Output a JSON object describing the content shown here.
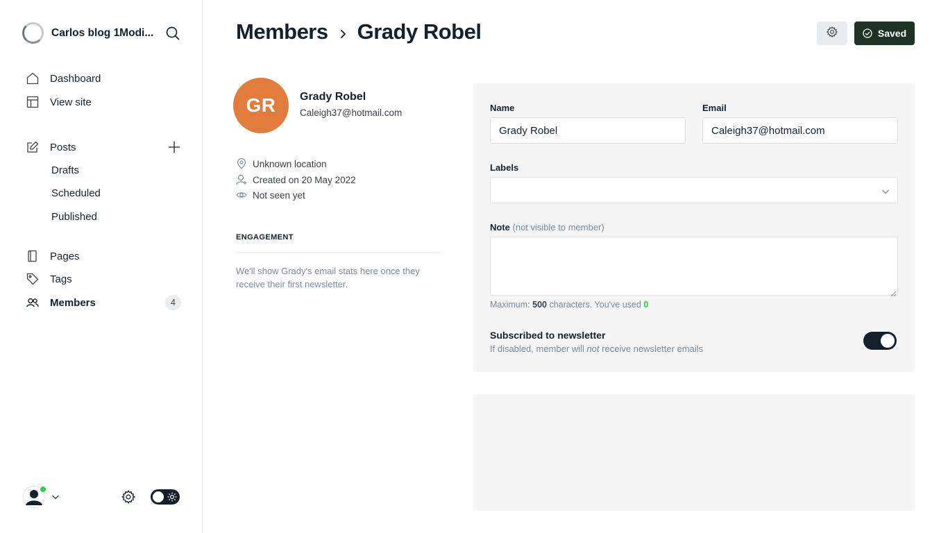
{
  "sidebar": {
    "site_title": "Carlos blog 1Modi...",
    "icons": {
      "brand": "site-logo",
      "search": "search-icon",
      "dashboard": "home-icon",
      "view_site": "layout-icon",
      "posts": "edit-icon",
      "add_post": "plus-icon",
      "pages": "page-icon",
      "tags": "tag-icon",
      "members": "members-icon",
      "settings": "gear-icon",
      "theme": "sun-icon"
    },
    "nav": {
      "dashboard": "Dashboard",
      "view_site": "View site",
      "posts": "Posts",
      "drafts": "Drafts",
      "scheduled": "Scheduled",
      "published": "Published",
      "pages": "Pages",
      "tags": "Tags",
      "members": "Members",
      "members_count": "4"
    },
    "user_status_color": "#30cf43"
  },
  "header": {
    "breadcrumb_parent": "Members",
    "breadcrumb_current": "Grady Robel",
    "saved_label": "Saved",
    "saved_color": "#1c3223"
  },
  "member": {
    "initials": "GR",
    "avatar_color": "#e27c3d",
    "name": "Grady Robel",
    "email": "Caleigh37@hotmail.com",
    "location": "Unknown location",
    "created": "Created on 20 May 2022",
    "seen": "Not seen yet"
  },
  "engagement": {
    "title": "ENGAGEMENT",
    "text": "We'll show Grady's email stats here once they receive their first newsletter."
  },
  "form": {
    "name_label": "Name",
    "name_value": "Grady Robel",
    "email_label": "Email",
    "email_value": "Caleigh37@hotmail.com",
    "labels_label": "Labels",
    "note_label": "Note",
    "note_hint_label": "(not visible to member)",
    "note_value": "",
    "max_prefix": "Maximum:",
    "max_value": "500",
    "max_suffix": "characters. You've used",
    "used_value": "0",
    "newsletter_title": "Subscribed to newsletter",
    "newsletter_desc_1": "If disabled, member will",
    "newsletter_desc_not": "not",
    "newsletter_desc_2": "receive newsletter emails",
    "newsletter_enabled": true
  }
}
